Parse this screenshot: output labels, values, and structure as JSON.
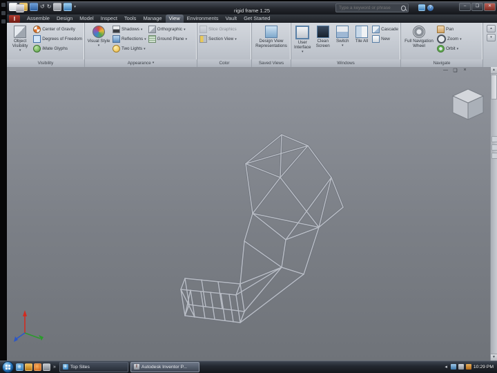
{
  "icons": {
    "dropdown": "▾",
    "minimize": "–",
    "maximize": "❑",
    "close": "✕",
    "doc_minimize": "—",
    "doc_restore": "❑",
    "doc_close": "×",
    "undo": "↺",
    "redo": "↻",
    "help": "?",
    "overflow": "»",
    "tray_collapse": "◂",
    "scroll_up": "▲",
    "scroll_down": "▼",
    "panel_toggle_up": "▴",
    "panel_toggle_down": "▾",
    "ie_letter": "e",
    "inventor_letter": "I"
  },
  "titlebar": {
    "title": "rigid frame 1.25",
    "search_placeholder": "Type a keyword or phrase"
  },
  "tabs": {
    "items": [
      "Assemble",
      "Design",
      "Model",
      "Inspect",
      "Tools",
      "Manage",
      "View",
      "Environments",
      "Vault",
      "Get Started"
    ],
    "active": "View"
  },
  "ribbon": {
    "visibility": {
      "label": "Visibility",
      "object_visibility": "Object Visibility",
      "rows": [
        "Center of Gravity",
        "Degrees of Freedom",
        "iMate Glyphs"
      ]
    },
    "appearance": {
      "label": "Appearance",
      "visual_style": "Visual Style",
      "col1": [
        "Shadows",
        "Reflections",
        "Two Lights"
      ],
      "col2": [
        "Orthographic",
        "Ground Plane"
      ]
    },
    "color": {
      "label": "Color",
      "rows": [
        "Slice Graphics",
        "Section View"
      ]
    },
    "saved_views": {
      "label": "Saved Views",
      "button": "Design View Representations"
    },
    "windows": {
      "label": "Windows",
      "big": [
        "User Interface",
        "Clean Screen",
        "Switch",
        "Tile All"
      ],
      "small": [
        "Cascade",
        "New"
      ]
    },
    "navigate": {
      "label": "Navigate",
      "wheel": "Full Navigation Wheel",
      "rows": [
        "Pan",
        "Zoom",
        "Orbit"
      ]
    }
  },
  "taskbar": {
    "tasks": [
      {
        "label": "Top Sites"
      },
      {
        "label": "Autodesk Inventor P..."
      }
    ],
    "time": "10:29 PM"
  }
}
